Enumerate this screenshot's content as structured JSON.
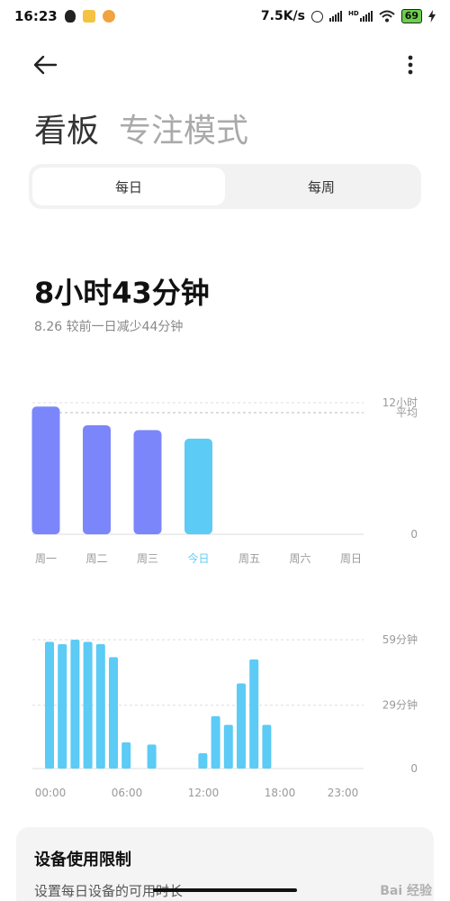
{
  "status_bar": {
    "time": "16:23",
    "net_speed": "7.5K/s",
    "signal_tag": "HD",
    "battery": "69"
  },
  "header": {
    "tabs": [
      {
        "label": "看板",
        "active": true
      },
      {
        "label": "专注模式",
        "active": false
      }
    ]
  },
  "segment": {
    "options": [
      {
        "label": "每日",
        "active": true
      },
      {
        "label": "每周",
        "active": false
      }
    ]
  },
  "summary": {
    "total": "8小时43分钟",
    "comparison": "8.26 较前一日减少44分钟"
  },
  "colors": {
    "past_day": "#7b86fb",
    "today": "#5ccbf5",
    "hour_bar": "#5ccbf5",
    "grid": "#dddddd"
  },
  "chart_data": [
    {
      "type": "bar",
      "categories": [
        "周一",
        "周二",
        "周三",
        "今日",
        "周五",
        "周六",
        "周日"
      ],
      "values": [
        11.65,
        9.95,
        9.5,
        8.72,
        null,
        null,
        null
      ],
      "highlight_category": "今日",
      "ylim": [
        0,
        12
      ],
      "y_ticks": [
        {
          "value": 12,
          "label": "12小时"
        },
        {
          "value": 0,
          "label": "0"
        }
      ],
      "reference_line": {
        "value": 11.1,
        "label": "平均"
      }
    },
    {
      "type": "bar",
      "categories": [
        "0",
        "1",
        "2",
        "3",
        "4",
        "5",
        "6",
        "7",
        "8",
        "9",
        "10",
        "11",
        "12",
        "13",
        "14",
        "15",
        "16",
        "17",
        "18",
        "19",
        "20",
        "21",
        "22",
        "23"
      ],
      "x_tick_labels": [
        {
          "index": 0,
          "label": "00:00"
        },
        {
          "index": 6,
          "label": "06:00"
        },
        {
          "index": 12,
          "label": "12:00"
        },
        {
          "index": 18,
          "label": "18:00"
        },
        {
          "index": 23,
          "label": "23:00"
        }
      ],
      "values": [
        58,
        57,
        59,
        58,
        57,
        51,
        12,
        0,
        11,
        0,
        0,
        0,
        7,
        24,
        20,
        39,
        50,
        20,
        0,
        0,
        0,
        0,
        0,
        0
      ],
      "ylim": [
        0,
        59
      ],
      "y_ticks": [
        {
          "value": 59,
          "label": "59分钟"
        },
        {
          "value": 29,
          "label": "29分钟"
        },
        {
          "value": 0,
          "label": "0"
        }
      ]
    }
  ],
  "limit_card": {
    "title": "设备使用限制",
    "subtitle": "设置每日设备的可用时长"
  },
  "watermark": "Bai 经验"
}
